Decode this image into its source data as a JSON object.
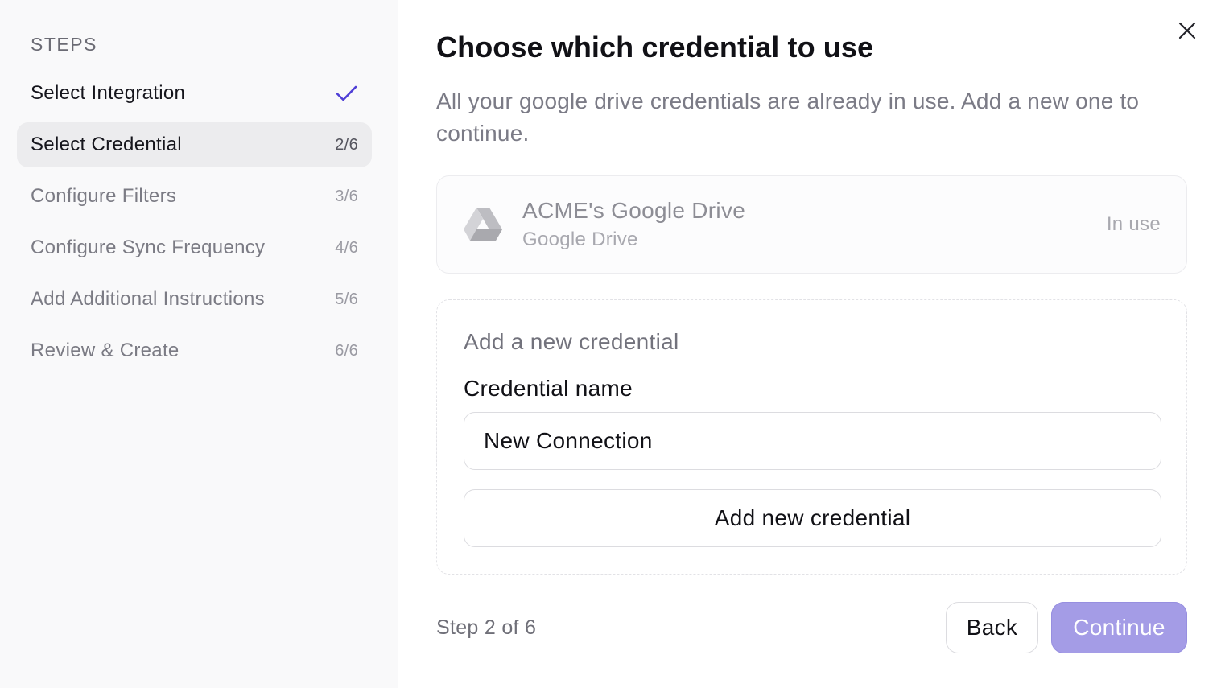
{
  "sidebar": {
    "heading": "STEPS",
    "steps": [
      {
        "label": "Select Integration",
        "status": "done",
        "count": ""
      },
      {
        "label": "Select Credential",
        "status": "active",
        "count": "2/6"
      },
      {
        "label": "Configure Filters",
        "status": "pending",
        "count": "3/6"
      },
      {
        "label": "Configure Sync Frequency",
        "status": "pending",
        "count": "4/6"
      },
      {
        "label": "Add Additional Instructions",
        "status": "pending",
        "count": "5/6"
      },
      {
        "label": "Review & Create",
        "status": "pending",
        "count": "6/6"
      }
    ]
  },
  "main": {
    "title": "Choose which credential to use",
    "subtitle": "All your google drive credentials are already in use. Add a new one to continue.",
    "existing_credential": {
      "name": "ACME's Google Drive",
      "type": "Google Drive",
      "status": "In use",
      "icon": "google-drive-icon"
    },
    "new_credential": {
      "heading": "Add a new credential",
      "field_label": "Credential name",
      "input_value": "New Connection",
      "add_button_label": "Add new credential"
    }
  },
  "footer": {
    "step_text": "Step 2 of 6",
    "back_label": "Back",
    "continue_label": "Continue"
  },
  "colors": {
    "accent": "#4f3fd6",
    "continue_bg": "#a49ce6",
    "sidebar_bg": "#f9f9fa",
    "active_step_bg": "#ececee"
  }
}
